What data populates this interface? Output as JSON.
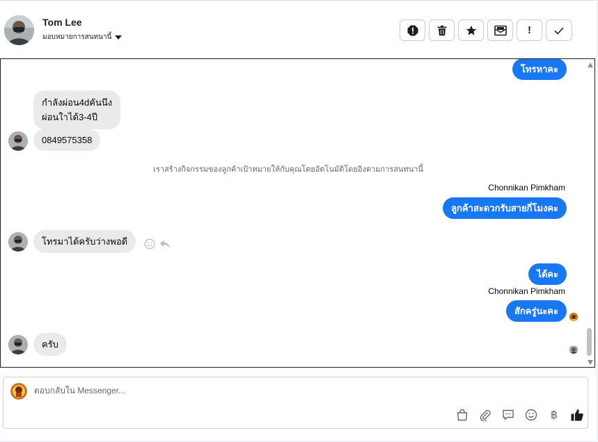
{
  "header": {
    "contact_name": "Tom Lee",
    "assign_label": "มอบหมายการสนทนานี้"
  },
  "toolbar": {
    "buttons": [
      "spam-icon",
      "trash-icon",
      "star-icon",
      "mark-unread-icon",
      "important-icon",
      "done-check-icon"
    ],
    "important_glyph": "!"
  },
  "conversation": {
    "out_top": "โทรหาคะ",
    "in_1_line1": "กำลังผ่อน4dคันนึง",
    "in_1_line2": "ผ่อนใาได้3-4ปี",
    "in_2": "0849575358",
    "system_note": "เราสร้างกิจกรรมของลูกค้าเป้าหมายให้กับคุณโดยอัตโนมัติโดยอิงตามการสนทนานี้",
    "sender_1": "Chonnikan Pimkham",
    "out_1": "ลูกค้าสะดวกรับสายกี่โมงคะ",
    "in_3": "โทรมาได้ครับว่างพอดี",
    "out_2": "ได้คะ",
    "sender_2": "Chonnikan Pimkham",
    "out_3": "สักครู่นะคะ",
    "in_4": "ครับ"
  },
  "composer": {
    "placeholder": "ตอบกลับใน Messenger...",
    "icons": [
      "shopping-bag-icon",
      "paperclip-icon",
      "saved-reply-icon",
      "emoji-icon",
      "baht-icon",
      "thumbs-up-icon"
    ],
    "baht_glyph": "฿"
  },
  "colors": {
    "accent": "#1877f2",
    "incoming_bubble": "#e9eaec",
    "border": "#ced0d4"
  }
}
